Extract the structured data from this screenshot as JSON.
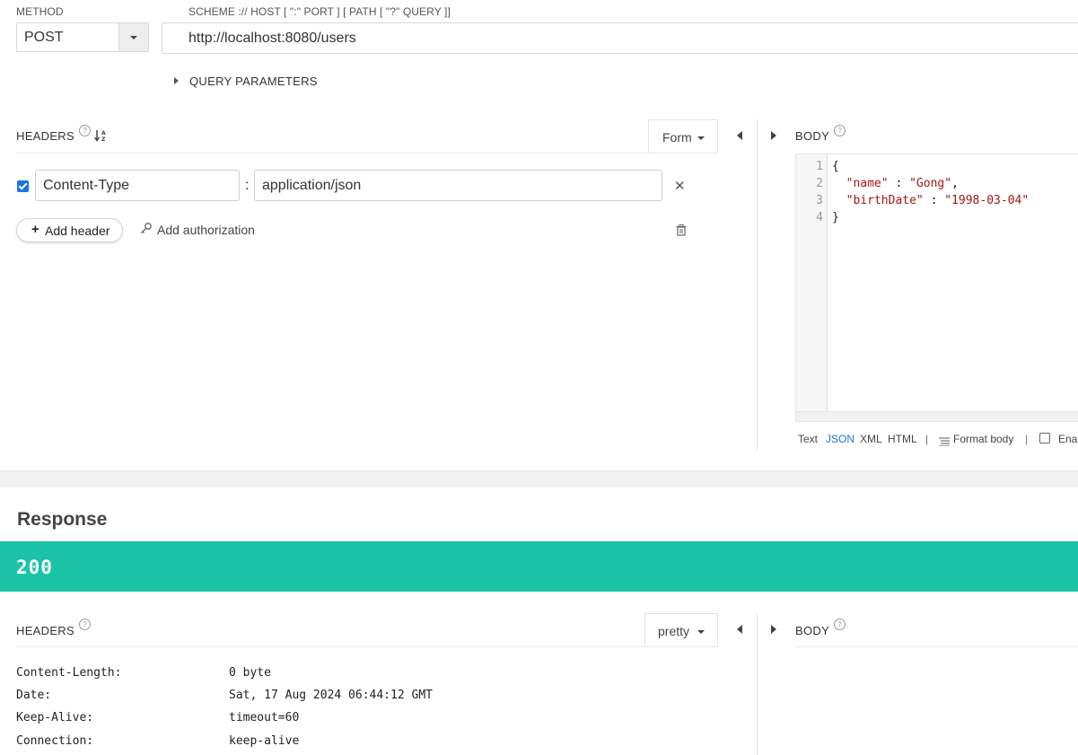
{
  "request": {
    "method_label": "METHOD",
    "url_label": "SCHEME :// HOST [ \":\" PORT ] [ PATH [ \"?\" QUERY ]]",
    "method": "POST",
    "url": "http://localhost:8080/users",
    "query_parameters_label": "QUERY PARAMETERS",
    "headers": {
      "title": "HEADERS",
      "mode": "Form",
      "rows": [
        {
          "enabled": true,
          "name": "Content-Type",
          "separator": ":",
          "value": "application/json"
        }
      ],
      "add_header_label": "Add header",
      "add_authorization_label": "Add authorization"
    },
    "body": {
      "title": "BODY",
      "lines": [
        {
          "no": "1",
          "text": "{"
        },
        {
          "no": "2",
          "key": "\"name\"",
          "sep": " : ",
          "value": "\"Gong\"",
          "trail": ","
        },
        {
          "no": "3",
          "key": "\"birthDate\"",
          "sep": " : ",
          "value": "\"1998-03-04\"",
          "trail": ""
        },
        {
          "no": "4",
          "text": "}"
        }
      ],
      "formats": [
        "Text",
        "JSON",
        "XML",
        "HTML"
      ],
      "active_format": "JSON",
      "separator": "|",
      "format_body_label": "Format body",
      "enable_label": "Enal"
    }
  },
  "response": {
    "title": "Response",
    "status": "200",
    "status_color": "#1bc3a6",
    "headers": {
      "title": "HEADERS",
      "mode": "pretty",
      "rows": [
        {
          "name": "Content-Length:",
          "value": "0 byte"
        },
        {
          "name": "Date:",
          "value": "Sat, 17 Aug 2024 06:44:12 GMT"
        },
        {
          "name": "Keep-Alive:",
          "value": "timeout=60"
        },
        {
          "name": "Connection:",
          "value": "keep-alive"
        }
      ]
    },
    "body": {
      "title": "BODY"
    }
  },
  "icons": {
    "help": "?",
    "sort": "↓ᴬ",
    "close": "✕",
    "plus": "+",
    "key": "⚲",
    "trash": "trash-icon"
  },
  "colors": {
    "accent": "#1a73e8",
    "status_ok": "#1bc3a6"
  }
}
